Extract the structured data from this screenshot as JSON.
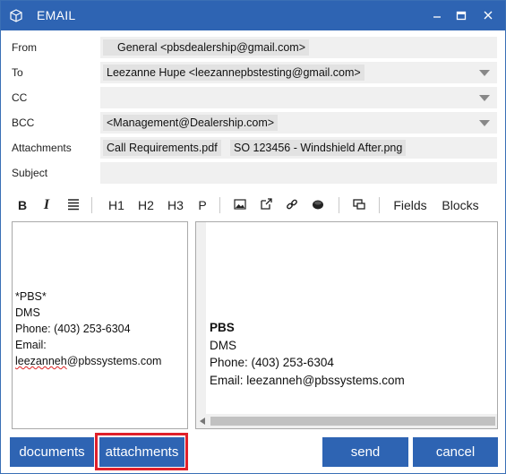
{
  "window": {
    "title": "EMAIL",
    "controls": [
      "minimize-icon",
      "maximize-icon",
      "close-icon"
    ]
  },
  "fields": {
    "from": {
      "label": "From",
      "value": "General  <pbsdealership@gmail.com>"
    },
    "to": {
      "label": "To",
      "value": "Leezanne Hupe <leezannepbstesting@gmail.com>"
    },
    "cc": {
      "label": "CC",
      "value": ""
    },
    "bcc": {
      "label": "BCC",
      "value": "<Management@Dealership.com>"
    },
    "attachments": {
      "label": "Attachments",
      "items": [
        "Call Requirements.pdf",
        "SO 123456 - Windshield After.png"
      ]
    },
    "subject": {
      "label": "Subject",
      "value": ""
    }
  },
  "toolbar": {
    "bold": "B",
    "italic": "I",
    "h1": "H1",
    "h2": "H2",
    "h3": "H3",
    "paragraph": "P",
    "fields": "Fields",
    "blocks": "Blocks",
    "icons": [
      "bold-icon",
      "italic-icon",
      "align-icon",
      "image-icon",
      "external-link-icon",
      "link-icon",
      "circle-icon",
      "window-icon"
    ]
  },
  "editor": {
    "lines": [
      "*PBS*",
      "DMS",
      "Phone: (403) 253-6304",
      "Email:"
    ],
    "email_misspelled": "leezanneh",
    "email_rest": "@pbssystems.com"
  },
  "preview": {
    "lines": [
      "PBS",
      "DMS",
      "Phone: (403) 253-6304",
      "Email: leezanneh@pbssystems.com"
    ]
  },
  "buttons": {
    "documents": "documents",
    "attachments": "attachments",
    "send": "send",
    "cancel": "cancel"
  },
  "colors": {
    "accent": "#2e64b3",
    "highlight": "#e0202a",
    "field_bg": "#f0f0f0"
  }
}
